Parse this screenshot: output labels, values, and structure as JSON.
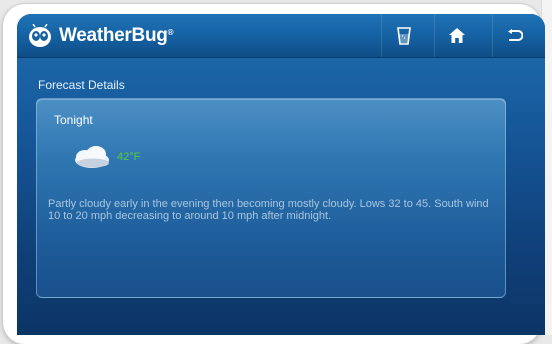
{
  "app": {
    "name": "WeatherBug",
    "trademark": "®"
  },
  "toolbar": {
    "buttons": [
      {
        "icon": "glass-icon",
        "label": ""
      },
      {
        "icon": "home-icon",
        "label": ""
      },
      {
        "icon": "back-icon",
        "label": ""
      }
    ]
  },
  "page": {
    "title": "Forecast Details"
  },
  "forecast": {
    "period": "Tonight",
    "icon": "partly-cloudy-night-icon",
    "temperature": "42°F",
    "description": "Partly cloudy early in the evening then becoming mostly cloudy. Lows 32 to 45. South wind 10 to 20 mph decreasing to around 10 mph after midnight."
  },
  "colors": {
    "header": "#1460a1",
    "background": "#0f3f78",
    "temperature": "#58c93a",
    "description": "#a9c6e0"
  }
}
